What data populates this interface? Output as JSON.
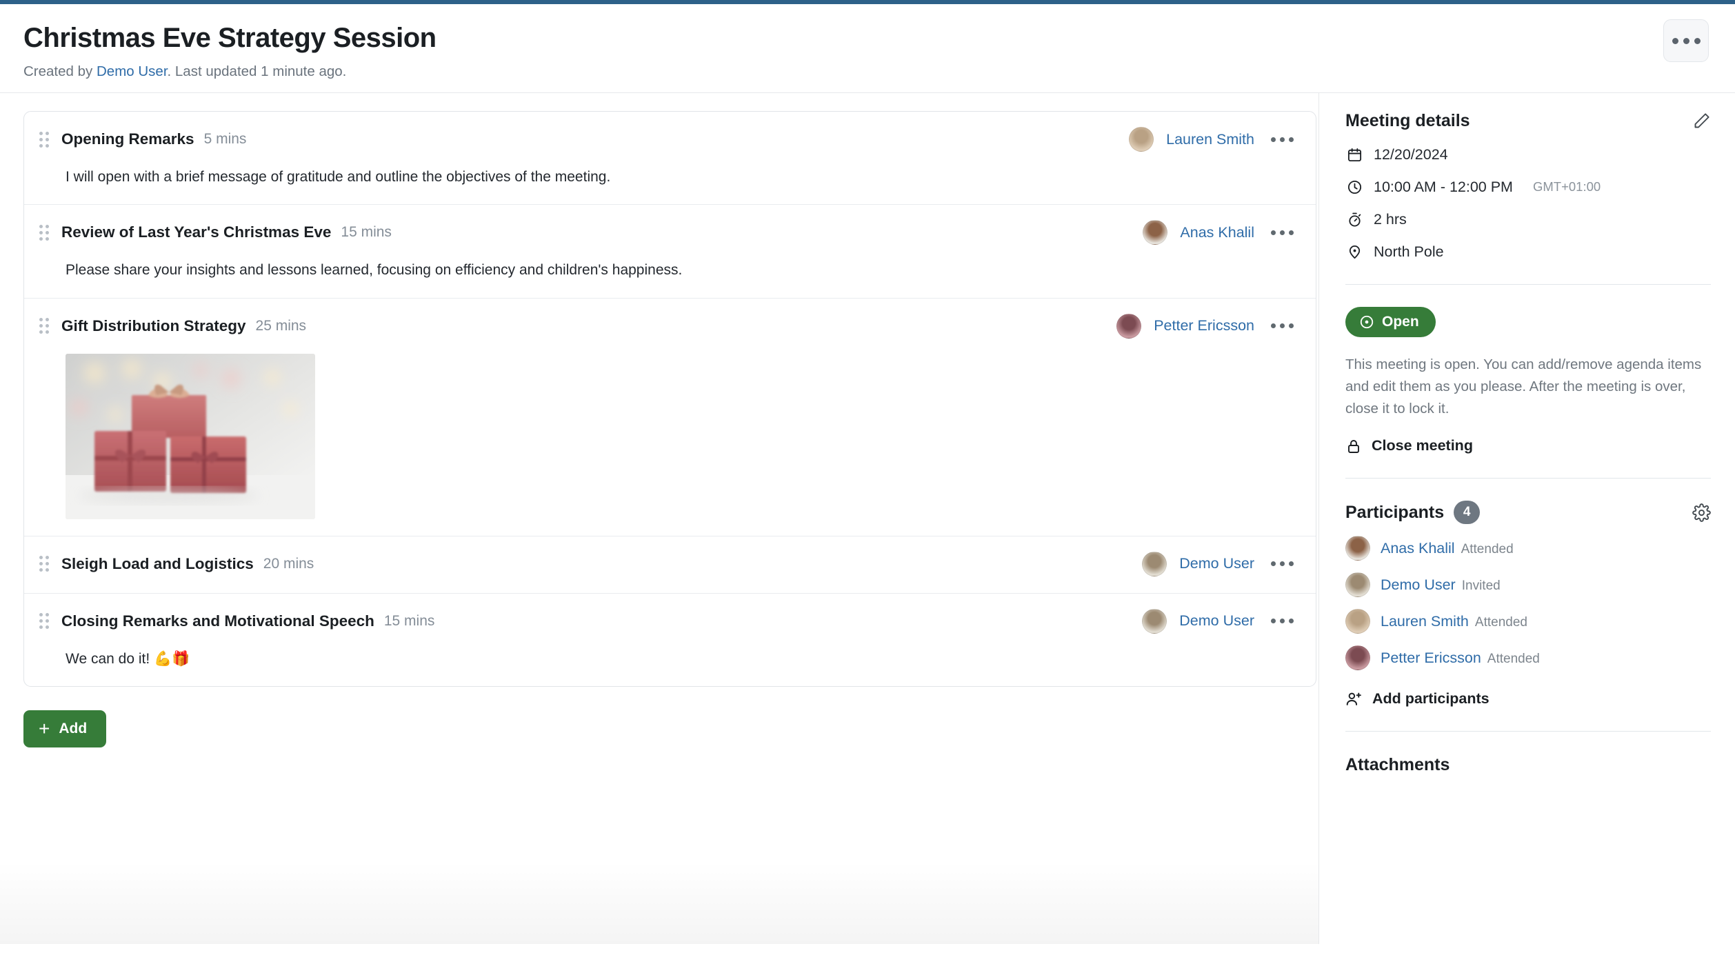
{
  "header": {
    "title": "Christmas Eve Strategy Session",
    "created_prefix": "Created by ",
    "created_by": "Demo User",
    "updated_suffix": ". Last updated 1 minute ago.",
    "overflow_icon": "ellipsis-icon"
  },
  "agenda": {
    "items": [
      {
        "title": "Opening Remarks",
        "duration": "5 mins",
        "description": "I will open with a brief message of gratitude and outline the objectives of the meeting.",
        "assignee": "Lauren Smith",
        "avatar_colors": [
          "#b9a184",
          "#dfcdb6"
        ],
        "has_image": false
      },
      {
        "title": "Review of Last Year's Christmas Eve",
        "duration": "15 mins",
        "description": "Please share your insights and lessons learned, focusing on efficiency and children's happiness.",
        "assignee": "Anas Khalil",
        "avatar_colors": [
          "#8c6247",
          "#e7e3dc"
        ],
        "has_image": false
      },
      {
        "title": "Gift Distribution Strategy",
        "duration": "25 mins",
        "description": "",
        "assignee": "Petter Ericsson",
        "avatar_colors": [
          "#7c4b52",
          "#c99aa0"
        ],
        "has_image": true,
        "image_alt": "red-gift-boxes-photo"
      },
      {
        "title": "Sleigh Load and Logistics",
        "duration": "20 mins",
        "description": "",
        "assignee": "Demo User",
        "avatar_colors": [
          "#9c8a72",
          "#e3ded3"
        ],
        "has_image": false
      },
      {
        "title": "Closing Remarks and Motivational Speech",
        "duration": "15 mins",
        "description": "We can do it! 💪🎁",
        "assignee": "Demo User",
        "avatar_colors": [
          "#9c8a72",
          "#e3ded3"
        ],
        "has_image": false
      }
    ],
    "add_label": "Add",
    "add_icon": "plus-icon"
  },
  "details": {
    "heading": "Meeting details",
    "edit_icon": "pencil-icon",
    "date": "12/20/2024",
    "date_icon": "calendar-icon",
    "time": "10:00 AM - 12:00 PM",
    "timezone": "GMT+01:00",
    "time_icon": "clock-icon",
    "duration": "2 hrs",
    "duration_icon": "stopwatch-icon",
    "location": "North Pole",
    "location_icon": "map-pin-icon"
  },
  "status": {
    "badge_label": "Open",
    "badge_icon": "dot-circle-icon",
    "badge_color": "#367c39",
    "description": "This meeting is open. You can add/remove agenda items and edit them as you please. After the meeting is over, close it to lock it.",
    "close_label": "Close meeting",
    "close_icon": "lock-icon"
  },
  "participants": {
    "heading": "Participants",
    "count": "4",
    "settings_icon": "gear-icon",
    "list": [
      {
        "name": "Anas Khalil",
        "status": "Attended",
        "avatar_colors": [
          "#8c6247",
          "#e7e3dc"
        ]
      },
      {
        "name": "Demo User",
        "status": "Invited",
        "avatar_colors": [
          "#9c8a72",
          "#e3ded3"
        ]
      },
      {
        "name": "Lauren Smith",
        "status": "Attended",
        "avatar_colors": [
          "#b9a184",
          "#dfcdb6"
        ]
      },
      {
        "name": "Petter Ericsson",
        "status": "Attended",
        "avatar_colors": [
          "#7c4b52",
          "#c99aa0"
        ]
      }
    ],
    "add_label": "Add participants",
    "add_icon": "person-plus-icon"
  },
  "attachments": {
    "heading": "Attachments"
  },
  "theme": {
    "accent_blue": "#2f6ca8",
    "green": "#367c39",
    "top_bar": "#2d6189",
    "muted": "#6a737d"
  }
}
